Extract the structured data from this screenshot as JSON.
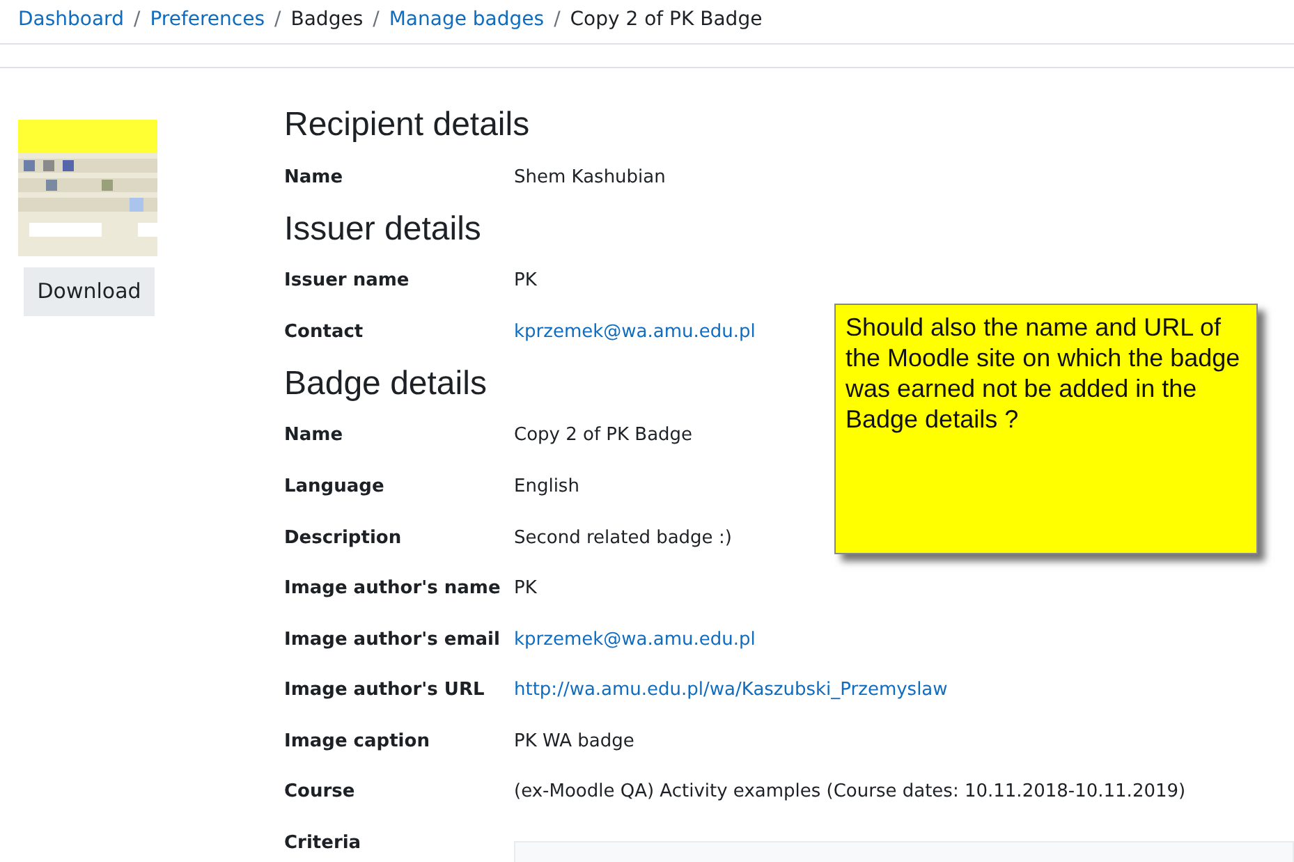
{
  "breadcrumb": [
    {
      "label": "Dashboard",
      "link": true
    },
    {
      "label": "Preferences",
      "link": true
    },
    {
      "label": "Badges",
      "link": false
    },
    {
      "label": "Manage badges",
      "link": true
    },
    {
      "label": "Copy 2 of PK Badge",
      "link": false
    }
  ],
  "breadcrumb_separator": "/",
  "download_button": "Download",
  "sections": [
    {
      "title": "Recipient details",
      "rows": [
        {
          "label": "Name",
          "value": "Shem Kashubian",
          "link": false
        }
      ]
    },
    {
      "title": "Issuer details",
      "rows": [
        {
          "label": "Issuer name",
          "value": "PK",
          "link": false
        },
        {
          "label": "Contact",
          "value": "kprzemek@wa.amu.edu.pl",
          "link": true
        }
      ]
    },
    {
      "title": "Badge details",
      "rows": [
        {
          "label": "Name",
          "value": "Copy 2 of PK Badge",
          "link": false
        },
        {
          "label": "Language",
          "value": "English",
          "link": false
        },
        {
          "label": "Description",
          "value": "Second related badge :)",
          "link": false
        },
        {
          "label": "Image author's name",
          "value": "PK",
          "link": false
        },
        {
          "label": "Image author's email",
          "value": "kprzemek@wa.amu.edu.pl",
          "link": true
        },
        {
          "label": "Image author's URL",
          "value": "http://wa.amu.edu.pl/wa/Kaszubski_Przemyslaw",
          "link": true
        },
        {
          "label": "Image caption",
          "value": "PK WA badge",
          "link": false
        },
        {
          "label": "Course",
          "value": "(ex-Moodle QA) Activity examples (Course dates: 10.11.2018-10.11.2019)",
          "link": false
        },
        {
          "label": "Criteria",
          "kind": "box"
        }
      ]
    }
  ],
  "note": "Should also the name and URL of the Moodle site on which the badge was earned not be added in the Badge details ?"
}
